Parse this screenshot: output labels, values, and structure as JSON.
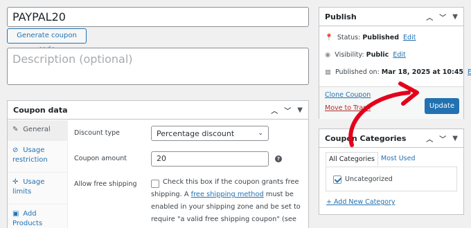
{
  "coupon": {
    "title_value": "PAYPAL20",
    "generate_label": "Generate coupon code",
    "description_placeholder": "Description (optional)"
  },
  "coupon_data": {
    "heading": "Coupon data",
    "tabs": [
      {
        "label_line1": "General",
        "label_line2": "",
        "icon": "wrench-icon"
      },
      {
        "label_line1": "Usage",
        "label_line2": "restriction",
        "icon": "ban-icon"
      },
      {
        "label_line1": "Usage",
        "label_line2": "limits",
        "icon": "limits-icon"
      },
      {
        "label_line1": "Add",
        "label_line2": "Products",
        "icon": "box-icon"
      }
    ],
    "discount_type_label": "Discount type",
    "discount_type_value": "Percentage discount",
    "coupon_amount_label": "Coupon amount",
    "coupon_amount_value": "20",
    "free_shipping_label": "Allow free shipping",
    "free_shipping_text1": "Check this box if the coupon grants free",
    "free_shipping_text2a": "shipping. A ",
    "free_shipping_link": "free shipping method",
    "free_shipping_text2b": " must be",
    "free_shipping_text3": "enabled in your shipping zone and be set to",
    "free_shipping_text4": "require \"a valid free shipping coupon\" (see the"
  },
  "publish": {
    "heading": "Publish",
    "status_label": "Status: ",
    "status_value": "Published",
    "visibility_label": "Visibility: ",
    "visibility_value": "Public",
    "published_label": "Published on: ",
    "published_value": "Mar 18, 2025 at 10:45",
    "edit_label": "Edit",
    "clone_label": "Clone Coupon",
    "trash_label": "Move to Trash",
    "update_label": "Update"
  },
  "categories": {
    "heading": "Coupon Categories",
    "tab_all": "All Categories",
    "tab_used": "Most Used",
    "item": "Uncategorized",
    "add_new": "+ Add New Category"
  },
  "colors": {
    "accent": "#2271b1",
    "trash": "#b32d2e",
    "arrow": "#e3001b"
  }
}
